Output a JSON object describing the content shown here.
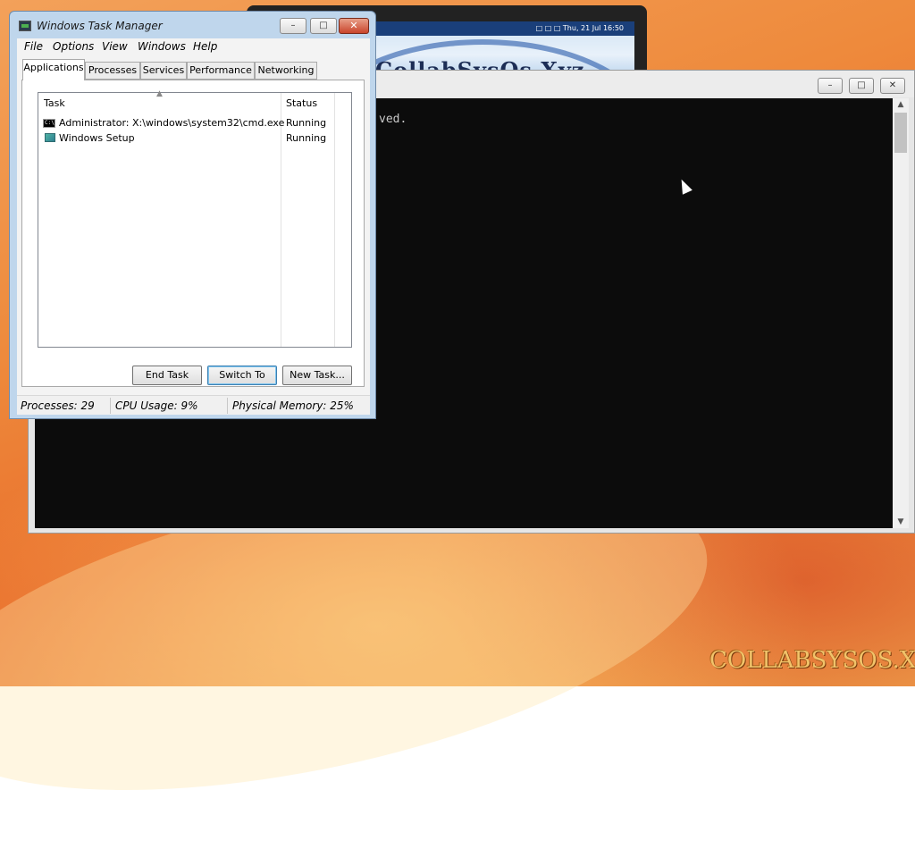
{
  "background_window": {
    "brand_text": "CollabSysOs.Xyz",
    "tray_text": "□ □ □  Thu, 21 Jul 16:50"
  },
  "cmd_window": {
    "visible_text": "ved.",
    "minimize": "–",
    "maximize": "□",
    "close": "✕"
  },
  "task_manager": {
    "title": "Windows Task Manager",
    "controls": {
      "minimize": "–",
      "maximize": "□",
      "close": "✕"
    },
    "menu": [
      "File",
      "Options",
      "View",
      "Windows",
      "Help"
    ],
    "tabs": [
      "Applications",
      "Processes",
      "Services",
      "Performance",
      "Networking"
    ],
    "active_tab": "Applications",
    "columns": {
      "task": "Task",
      "status": "Status"
    },
    "rows": [
      {
        "icon": "cmd-icon",
        "task": "Administrator: X:\\windows\\system32\\cmd.exe",
        "status": "Running"
      },
      {
        "icon": "setup-icon",
        "task": "Windows Setup",
        "status": "Running"
      }
    ],
    "buttons": {
      "end_task": "End Task",
      "switch_to": "Switch To",
      "new_task": "New Task..."
    },
    "status_bar": {
      "processes": "Processes: 29",
      "cpu": "CPU Usage: 9%",
      "memory": "Physical Memory: 25%"
    }
  },
  "watermark": "COLLABSYSOS.XYZ"
}
